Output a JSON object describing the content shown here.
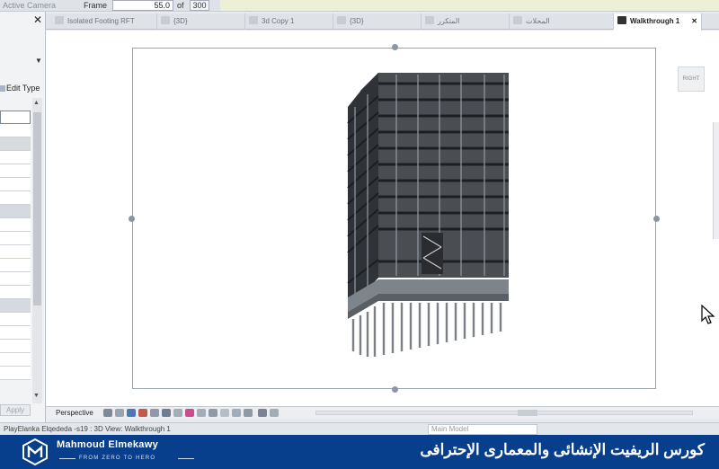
{
  "options_bar": {
    "active_camera": "Active Camera",
    "frame_label": "Frame",
    "frame_value": "55.0",
    "of_label": "of",
    "total_frames": "300"
  },
  "properties": {
    "close": "✕",
    "dropdown": "▼",
    "edit_type": "Edit Type",
    "apply": "Apply"
  },
  "tabs": [
    {
      "label": "Isolated Footing RFT",
      "close": "✕"
    },
    {
      "label": "{3D}",
      "close": "✕"
    },
    {
      "label": "3d Copy 1",
      "close": "✕"
    },
    {
      "label": "{3D}",
      "close": "✕"
    },
    {
      "label": "المتكرر",
      "close": "✕"
    },
    {
      "label": "المحلات",
      "close": "✕"
    },
    {
      "label": "Walkthrough 1",
      "close": "✕"
    }
  ],
  "viewport": {
    "viewcube_face": "RIGHT"
  },
  "view_control": {
    "perspective": "Perspective"
  },
  "status_bar": {
    "text": "PlayElanka Elqededa -s19 : 3D View: Walkthrough 1",
    "model": "Main Model"
  },
  "brand": {
    "name": "Mahmoud Elmekawy",
    "tagline": "FROM ZERO TO HERO",
    "course_title": "كورس الريفيت الإنشائى والمعمارى الإحترافى",
    "color": "#083f8c"
  }
}
